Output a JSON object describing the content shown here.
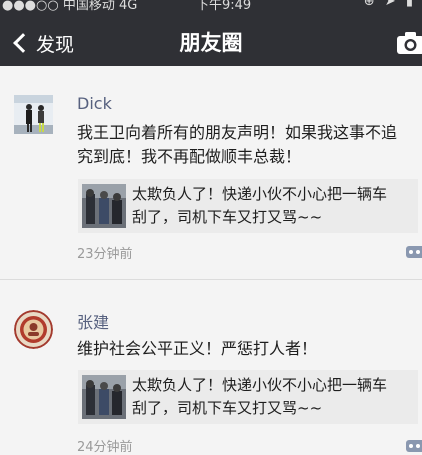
{
  "status_bar": {
    "carrier": "●●●○○ 中国移动",
    "network": "4G",
    "time": "下午9:49",
    "indicators": "⊕ ➤ ▮"
  },
  "nav": {
    "back_label": "发现",
    "title": "朋友圈",
    "camera_icon": "camera-icon"
  },
  "posts": [
    {
      "name": "Dick",
      "text_lines": [
        "我王卫向着所有的朋友声明！如果我这事不追",
        "究到底！我不再配做顺丰总裁！"
      ],
      "shared": {
        "lines": [
          "太欺负人了！快递小伙不小心把一辆车",
          "刮了，司机下车又打又骂~~"
        ]
      },
      "time": "23分钟前"
    },
    {
      "name": "张建",
      "text_lines": [
        "维护社会公平正义！严惩打人者！"
      ],
      "shared": {
        "lines": [
          "太欺负人了！快递小伙不小心把一辆车",
          "刮了，司机下车又打又骂~~"
        ]
      },
      "time": "24分钟前"
    }
  ],
  "colors": {
    "nav_bg": "#2f3035",
    "name": "#57617f",
    "share_bg": "#ebebeb",
    "time": "#9a9a9a"
  }
}
